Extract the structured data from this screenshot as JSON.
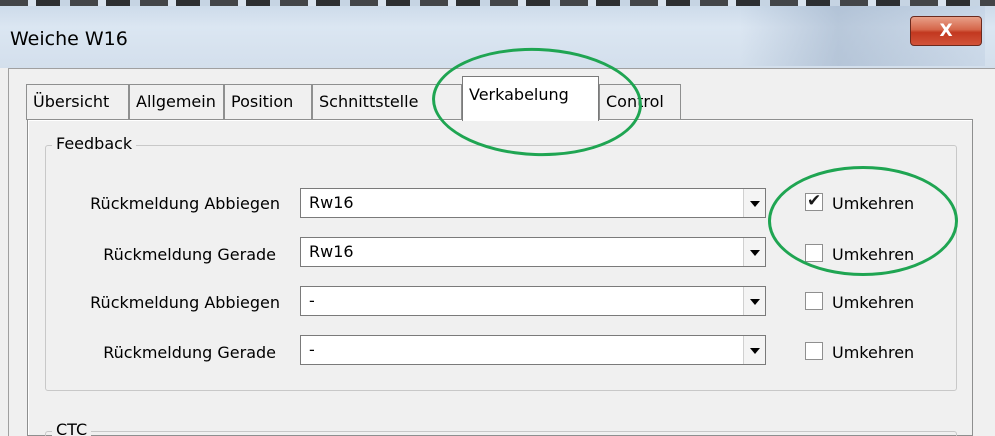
{
  "window": {
    "title": "Weiche W16",
    "close_label": "X"
  },
  "tabs": [
    {
      "label": "Übersicht",
      "active": false
    },
    {
      "label": "Allgemein",
      "active": false
    },
    {
      "label": "Position",
      "active": false
    },
    {
      "label": "Schnittstelle",
      "active": false
    },
    {
      "label": "Verkabelung",
      "active": true
    },
    {
      "label": "Control",
      "active": false
    }
  ],
  "feedback": {
    "group_label": "Feedback",
    "rows": [
      {
        "label": "Rückmeldung Abbiegen",
        "value": "Rw16",
        "invert_label": "Umkehren",
        "invert_checked": true
      },
      {
        "label": "Rückmeldung Gerade",
        "value": "Rw16",
        "invert_label": "Umkehren",
        "invert_checked": false
      },
      {
        "label": "Rückmeldung Abbiegen",
        "value": "-",
        "invert_label": "Umkehren",
        "invert_checked": false
      },
      {
        "label": "Rückmeldung Gerade",
        "value": "-",
        "invert_label": "Umkehren",
        "invert_checked": false
      }
    ]
  },
  "ctc": {
    "group_label": "CTC"
  },
  "colors": {
    "annotation": "#1fa552",
    "close_button": "#c2381f"
  },
  "icons": {
    "close": "close-icon",
    "dropdown": "chevron-down-icon",
    "check": "checkmark-icon"
  }
}
